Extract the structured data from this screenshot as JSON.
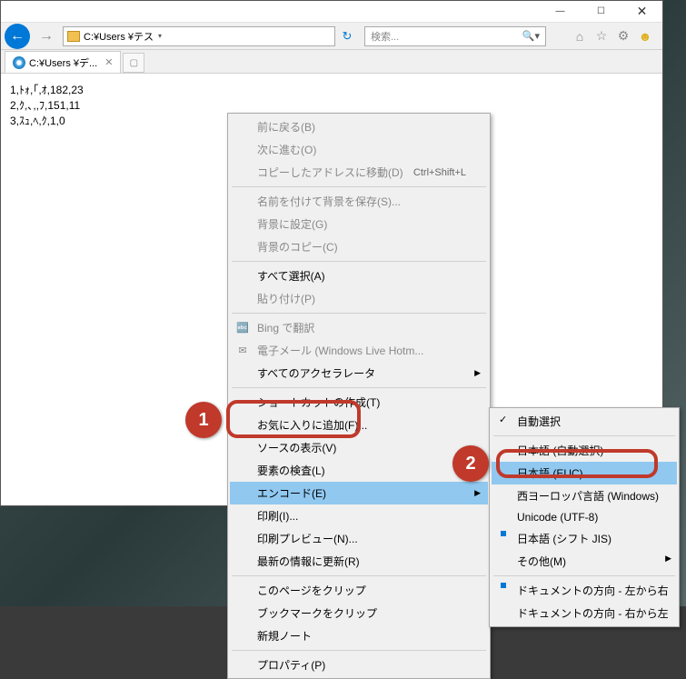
{
  "window": {
    "address": "C:¥Users                                       ¥テス",
    "search_placeholder": "検索...",
    "tab_title": "C:¥Users                ¥デ..."
  },
  "content_lines": [
    "1,ﾄｫ,｢,ｵ,182,23",
    "2,ｸ,､,,ﾌ,151,11",
    "3,ｽｭ,ﾍ,ｸ,1,0"
  ],
  "menu": {
    "back": "前に戻る(B)",
    "forward": "次に進む(O)",
    "goto_copied": "コピーしたアドレスに移動(D)",
    "goto_shortcut": "Ctrl+Shift+L",
    "save_bg_as": "名前を付けて背景を保存(S)...",
    "set_bg": "背景に設定(G)",
    "copy_bg": "背景のコピー(C)",
    "select_all": "すべて選択(A)",
    "paste": "貼り付け(P)",
    "bing_translate": "Bing で翻訳",
    "email": "電子メール (Windows Live Hotm...",
    "all_accel": "すべてのアクセラレータ",
    "create_shortcut": "ショートカットの作成(T)",
    "add_fav": "お気に入りに追加(F)...",
    "view_source": "ソースの表示(V)",
    "inspect": "要素の検査(L)",
    "encoding": "エンコード(E)",
    "print": "印刷(I)...",
    "print_preview": "印刷プレビュー(N)...",
    "refresh": "最新の情報に更新(R)",
    "clip_page": "このページをクリップ",
    "clip_bookmark": "ブックマークをクリップ",
    "new_note": "新規ノート",
    "properties": "プロパティ(P)"
  },
  "submenu": {
    "auto": "自動選択",
    "jp_auto": "日本語 (自動選択)",
    "jp_euc": "日本語 (EUC)",
    "west": "西ヨーロッパ言語 (Windows)",
    "utf8": "Unicode (UTF-8)",
    "sjis": "日本語 (シフト JIS)",
    "other": "その他(M)",
    "ltr": "ドキュメントの方向 - 左から右",
    "rtl": "ドキュメントの方向 - 右から左"
  },
  "callouts": {
    "one": "1",
    "two": "2"
  }
}
